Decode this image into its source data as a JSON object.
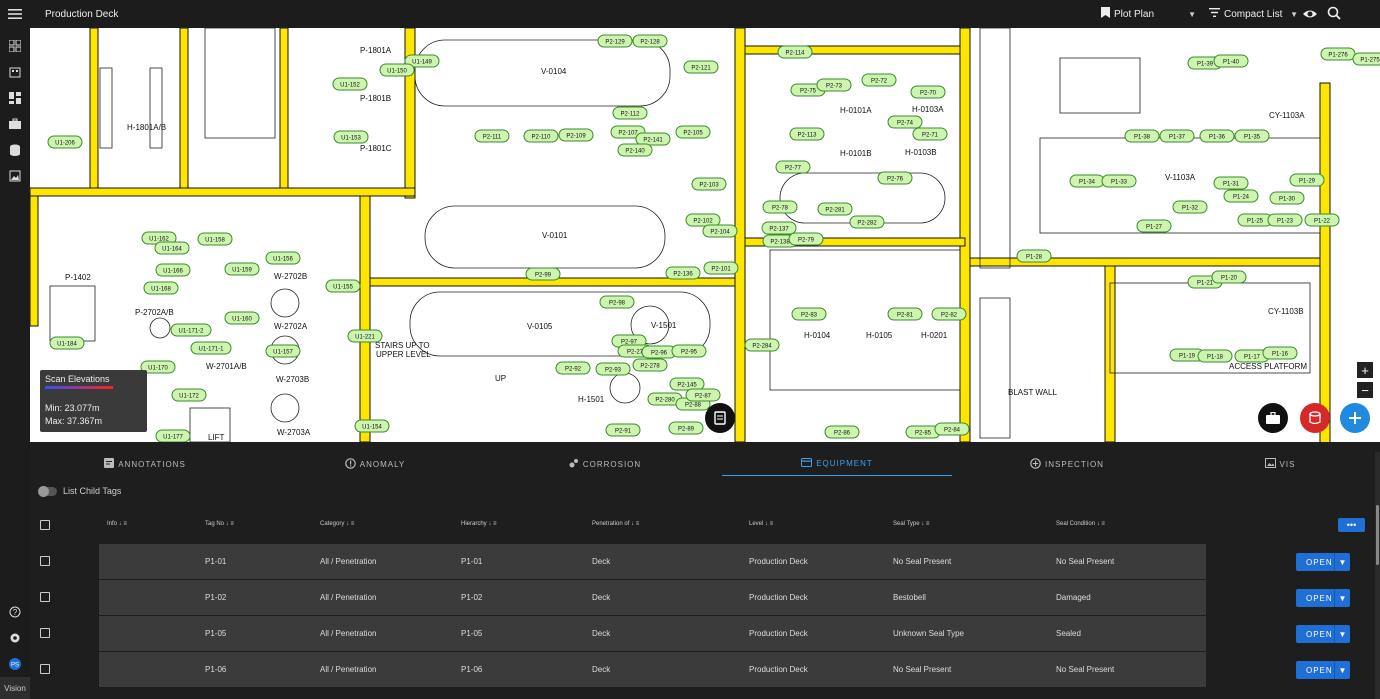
{
  "header": {
    "title": "Production Deck",
    "plot_plan_label": "Plot Plan",
    "compact_list_label": "Compact List"
  },
  "scan": {
    "title": "Scan Elevations",
    "min": "Min: 23.077m",
    "max": "Max: 37.367m"
  },
  "app": {
    "badge": "Vision"
  },
  "map_labels": [
    {
      "t": "P-1801A"
    },
    {
      "t": "P-1801B"
    },
    {
      "t": "P-1801C"
    },
    {
      "t": "H-1801A/B"
    },
    {
      "t": "V-0104"
    },
    {
      "t": "V-0101"
    },
    {
      "t": "V-0105"
    },
    {
      "t": "V-1501"
    },
    {
      "t": "H-1501"
    },
    {
      "t": "H-0101A"
    },
    {
      "t": "H-0101B"
    },
    {
      "t": "H-0103A"
    },
    {
      "t": "H-0103B"
    },
    {
      "t": "H-0104"
    },
    {
      "t": "H-0105"
    },
    {
      "t": "H-0201"
    },
    {
      "t": "CY-1103A"
    },
    {
      "t": "CY-1103B"
    },
    {
      "t": "V-1103A"
    },
    {
      "t": "P-1402"
    },
    {
      "t": "P-2702A/B"
    },
    {
      "t": "W-2702B"
    },
    {
      "t": "W-2702A"
    },
    {
      "t": "W-2701A/B"
    },
    {
      "t": "W-2703B"
    },
    {
      "t": "W-2703A"
    },
    {
      "t": "STAIRS UP TO"
    },
    {
      "t": "UPPER LEVEL"
    },
    {
      "t": "LIFT"
    },
    {
      "t": "UP"
    },
    {
      "t": "BLAST WALL"
    },
    {
      "t": "ACCESS PLATFORM"
    }
  ],
  "tags": [
    "U1-206",
    "U1-149",
    "U1-150",
    "U1-152",
    "U1-153",
    "U1-158",
    "U1-159",
    "U1-156",
    "U1-155",
    "U1-160",
    "U1-168",
    "U1-171-2",
    "U1-171-1",
    "U1-157",
    "U1-170",
    "U1-172",
    "U1-184",
    "U1-177",
    "U1-154",
    "U1-221",
    "U1-162",
    "U1-164",
    "U1-166",
    "P2-129",
    "P2-128",
    "P2-121",
    "P2-111",
    "P2-110",
    "P2-109",
    "P2-112",
    "P2-107",
    "P2-141",
    "P2-140",
    "P2-105",
    "P2-103",
    "P2-102",
    "P2-104",
    "P2-99",
    "P2-136",
    "P2-101",
    "P2-98",
    "P2-97",
    "P2-27",
    "P2-96",
    "P2-95",
    "P2-92",
    "P2-93",
    "P2-278",
    "P2-145",
    "P2-280",
    "P2-88",
    "P2-87",
    "P2-91",
    "P2-89",
    "P2-114",
    "P2-75",
    "P2-73",
    "P2-72",
    "P2-70",
    "P2-74",
    "P2-71",
    "P2-113",
    "P2-77",
    "P2-76",
    "P2-78",
    "P2-281",
    "P2-282",
    "P2-137",
    "P2-138",
    "P2-79",
    "P2-83",
    "P2-81",
    "P2-82",
    "P2-284",
    "P2-86",
    "P2-85",
    "P2-84",
    "P1-39",
    "P1-40",
    "P1-276",
    "P1-275",
    "P1-38",
    "P1-37",
    "P1-36",
    "P1-35",
    "P1-34",
    "P1-33",
    "P1-31",
    "P1-29",
    "P1-24",
    "P1-30",
    "P1-32",
    "P1-27",
    "P1-25",
    "P1-23",
    "P1-22",
    "P1-28",
    "P1-21",
    "P1-20",
    "P1-19",
    "P1-18",
    "P1-17",
    "P1-16"
  ],
  "tabs": [
    {
      "label": "ANNOTATIONS"
    },
    {
      "label": "ANOMALY"
    },
    {
      "label": "CORROSION"
    },
    {
      "label": "EQUIPMENT"
    },
    {
      "label": "INSPECTION"
    },
    {
      "label": "VIS"
    }
  ],
  "list_child_tags": "List Child Tags",
  "columns": [
    "Info",
    "Tag No",
    "Category",
    "Hierarchy",
    "Penetration of",
    "Level",
    "Seal Type",
    "Seal Condition"
  ],
  "more_label": "•••",
  "open_label": "OPEN",
  "rows": [
    {
      "tag": "P1-01",
      "category": "All / Penetration",
      "hierarchy": "P1-01",
      "penetration": "Deck",
      "level": "Production Deck",
      "seal_type": "No Seal Present",
      "seal_condition": "No Seal Present"
    },
    {
      "tag": "P1-02",
      "category": "All / Penetration",
      "hierarchy": "P1-02",
      "penetration": "Deck",
      "level": "Production Deck",
      "seal_type": "Bestobell",
      "seal_condition": "Damaged"
    },
    {
      "tag": "P1-05",
      "category": "All / Penetration",
      "hierarchy": "P1-05",
      "penetration": "Deck",
      "level": "Production Deck",
      "seal_type": "Unknown Seal Type",
      "seal_condition": "Sealed"
    },
    {
      "tag": "P1-06",
      "category": "All / Penetration",
      "hierarchy": "P1-06",
      "penetration": "Deck",
      "level": "Production Deck",
      "seal_type": "No Seal Present",
      "seal_condition": "No Seal Present"
    }
  ],
  "colors": {
    "accent": "#1f6fd6",
    "tab_active": "#3ea0f0",
    "wall": "#ffe600",
    "tag_fill": "#cdf5b0",
    "tag_border": "#3a8a2a",
    "fab_red": "#d62828",
    "fab_blue": "#1f8ae0"
  }
}
